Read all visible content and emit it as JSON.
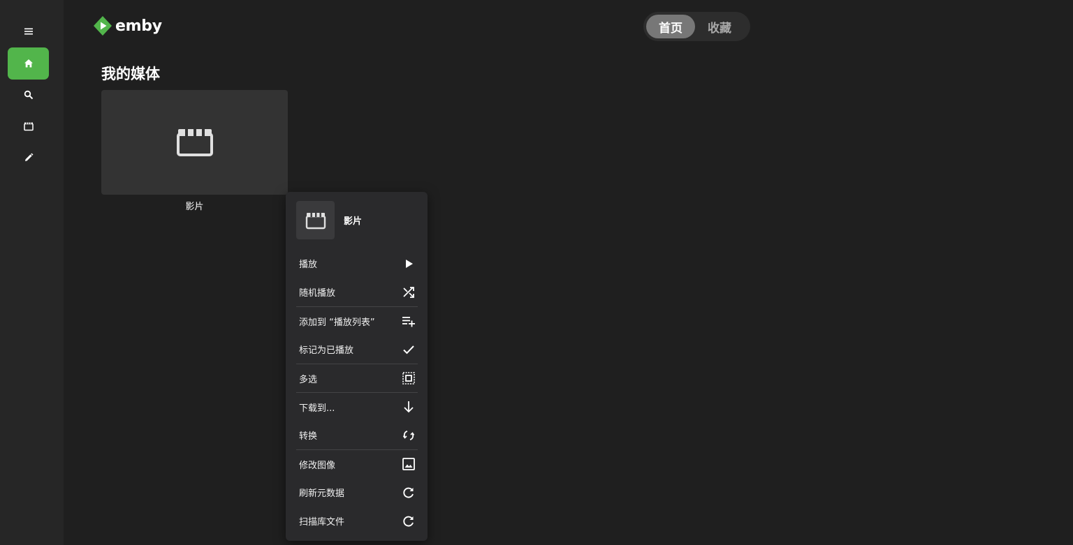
{
  "app": {
    "logo_text": "emby"
  },
  "sidebar": {
    "items": [
      {
        "name": "menu",
        "icon": "hamburger-icon",
        "active": false
      },
      {
        "name": "home",
        "icon": "home-icon",
        "active": true
      },
      {
        "name": "search",
        "icon": "search-icon",
        "active": false
      },
      {
        "name": "movies",
        "icon": "movie-icon",
        "active": false
      },
      {
        "name": "edit",
        "icon": "pencil-icon",
        "active": false
      }
    ]
  },
  "header": {
    "tabs": [
      {
        "label": "首页",
        "active": true
      },
      {
        "label": "收藏",
        "active": false
      }
    ]
  },
  "main": {
    "section_title": "我的媒体",
    "library": {
      "label": "影片",
      "icon": "movie-icon"
    }
  },
  "context_menu": {
    "title": "影片",
    "icon": "movie-icon",
    "items": [
      {
        "label": "播放",
        "icon": "play-icon"
      },
      {
        "label": "随机播放",
        "icon": "shuffle-icon"
      },
      {
        "label": "添加到 “播放列表”",
        "icon": "playlist-add-icon"
      },
      {
        "label": "标记为已播放",
        "icon": "check-icon"
      },
      {
        "label": "多选",
        "icon": "select-all-icon"
      },
      {
        "label": "下载到...",
        "icon": "download-arrow-icon"
      },
      {
        "label": "转换",
        "icon": "convert-icon"
      },
      {
        "label": "修改图像",
        "icon": "image-icon"
      },
      {
        "label": "刷新元数据",
        "icon": "refresh-icon"
      },
      {
        "label": "扫描库文件",
        "icon": "refresh-icon"
      }
    ]
  },
  "colors": {
    "accent": "#52b54b",
    "background": "#1f1f1f",
    "sidebar": "#262626",
    "menu": "#2a2a2c"
  }
}
